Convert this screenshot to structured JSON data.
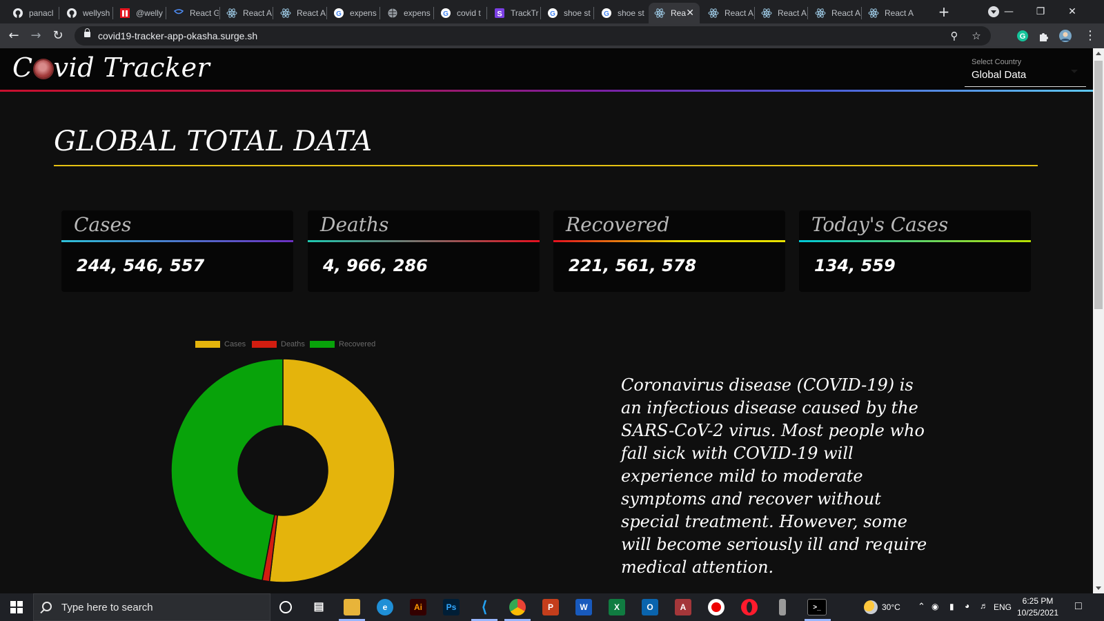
{
  "browser": {
    "tabs": [
      {
        "title": "panacl",
        "icon": "github-icon"
      },
      {
        "title": "wellysh",
        "icon": "github-icon"
      },
      {
        "title": "@welly",
        "icon": "red-square-icon"
      },
      {
        "title": "React G",
        "icon": "react-grid-icon"
      },
      {
        "title": "React A",
        "icon": "react-icon"
      },
      {
        "title": "React A",
        "icon": "react-icon"
      },
      {
        "title": "expens",
        "icon": "google-icon"
      },
      {
        "title": "expens",
        "icon": "globe-icon"
      },
      {
        "title": "covid t",
        "icon": "google-icon"
      },
      {
        "title": "TrackTr",
        "icon": "purple-s-icon"
      },
      {
        "title": "shoe st",
        "icon": "google-icon"
      },
      {
        "title": "shoe st",
        "icon": "google-icon"
      },
      {
        "title": "Rea",
        "icon": "react-icon",
        "active": true
      },
      {
        "title": "React A",
        "icon": "react-icon"
      },
      {
        "title": "React A",
        "icon": "react-icon"
      },
      {
        "title": "React A",
        "icon": "react-icon"
      },
      {
        "title": "React A",
        "icon": "react-icon"
      }
    ],
    "url": "covid19-tracker-app-okasha.surge.sh"
  },
  "app": {
    "brand_prefix": "C",
    "brand_suffix": "vid Tracker",
    "country_select": {
      "label": "Select Country",
      "value": "Global Data"
    },
    "section_title": "GLOBAL TOTAL DATA",
    "cards": [
      {
        "label": "Cases",
        "value": "244, 546, 557",
        "accent": "#4db6e8"
      },
      {
        "label": "Deaths",
        "value": "4, 966, 286",
        "accent": "#e3101f"
      },
      {
        "label": "Recovered",
        "value": "221, 561, 578",
        "accent": "#e8e000"
      },
      {
        "label": "Today's Cases",
        "value": "134, 559",
        "accent": "#b8e000"
      }
    ],
    "info_text": "Coronavirus disease (COVID-19) is an infectious disease caused by the SARS-CoV-2 virus. Most people who fall sick with COVID-19 will experience mild to moderate symptoms and recover without special treatment. However, some will become seriously ill and require medical attention."
  },
  "chart_data": {
    "type": "pie",
    "categories": [
      "Cases",
      "Deaths",
      "Recovered"
    ],
    "values": [
      244546557,
      4966286,
      221561578
    ],
    "colors": [
      "#e4b40c",
      "#d21d10",
      "#08a30a"
    ],
    "legend": "top"
  },
  "taskbar": {
    "search_placeholder": "Type here to search",
    "weather": "30°C",
    "language": "ENG",
    "time": "6:25 PM",
    "date": "10/25/2021"
  }
}
